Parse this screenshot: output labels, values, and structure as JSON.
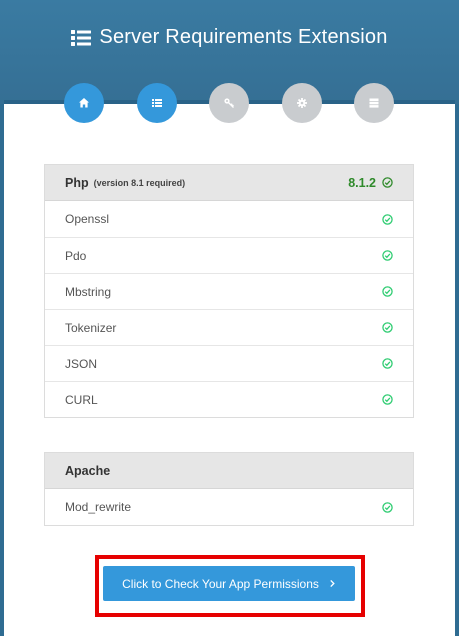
{
  "header": {
    "title": "Server Requirements Extension",
    "title_icon": "list-icon"
  },
  "steps": [
    {
      "icon": "home-icon",
      "state": "completed"
    },
    {
      "icon": "list-icon",
      "state": "active"
    },
    {
      "icon": "key-icon",
      "state": "inactive"
    },
    {
      "icon": "gear-icon",
      "state": "inactive"
    },
    {
      "icon": "server-icon",
      "state": "inactive"
    }
  ],
  "php": {
    "name": "Php",
    "note": "(version 8.1 required)",
    "version": "8.1.2",
    "status": "ok",
    "extensions": [
      {
        "name": "Openssl",
        "status": "ok"
      },
      {
        "name": "Pdo",
        "status": "ok"
      },
      {
        "name": "Mbstring",
        "status": "ok"
      },
      {
        "name": "Tokenizer",
        "status": "ok"
      },
      {
        "name": "JSON",
        "status": "ok"
      },
      {
        "name": "CURL",
        "status": "ok"
      }
    ]
  },
  "apache": {
    "name": "Apache",
    "modules": [
      {
        "name": "Mod_rewrite",
        "status": "ok"
      }
    ]
  },
  "action": {
    "label": "Click to Check Your App Permissions",
    "icon": "chevron-right-icon"
  },
  "colors": {
    "header": "#3a7ba2",
    "accent": "#3498db",
    "ok": "#2ecc71",
    "version": "#2f8a2b",
    "highlight": "#e60000"
  }
}
